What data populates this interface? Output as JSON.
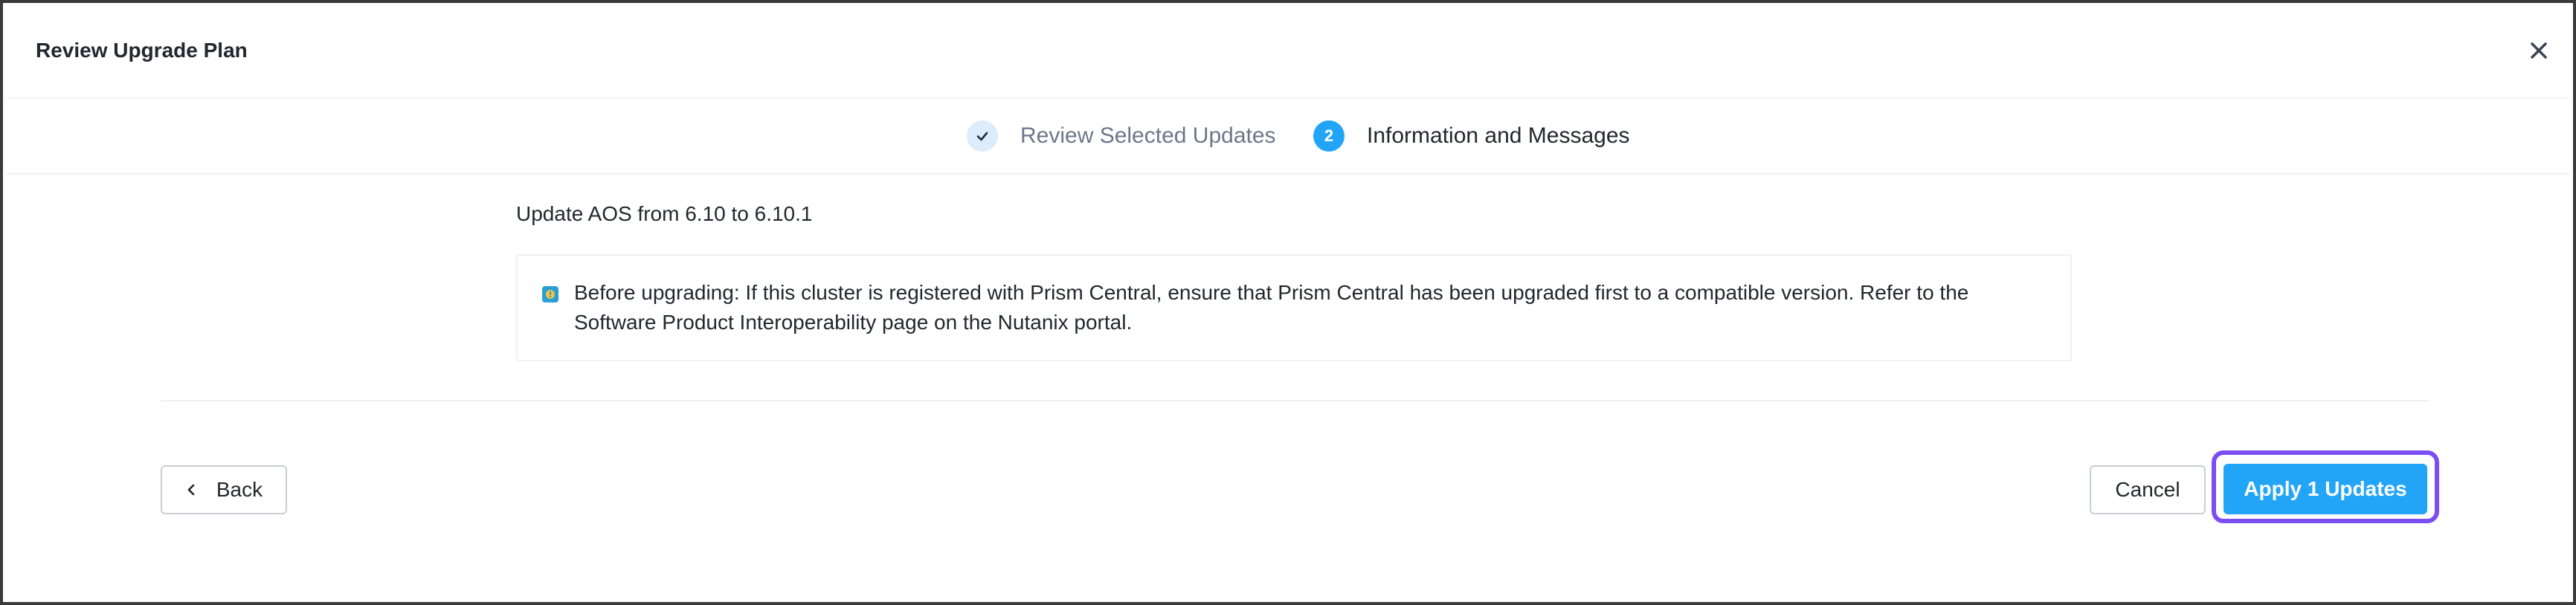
{
  "dialog": {
    "title": "Review Upgrade Plan"
  },
  "stepper": {
    "steps": [
      {
        "label": "Review Selected Updates",
        "state": "completed",
        "marker": "✓"
      },
      {
        "label": "Information and Messages",
        "state": "active",
        "marker": "2"
      }
    ]
  },
  "content": {
    "update_title": "Update AOS from 6.10 to 6.10.1",
    "message": {
      "icon": "info-icon",
      "text": "Before upgrading: If this cluster is registered with Prism Central, ensure that Prism Central has been upgraded first to a compatible version. Refer to the Software Product Interoperability page on the Nutanix portal."
    }
  },
  "footer": {
    "back_label": "Back",
    "cancel_label": "Cancel",
    "apply_label": "Apply 1 Updates"
  },
  "colors": {
    "primary": "#22a5f7",
    "focus_ring": "#7b4df2",
    "completed_step_bg": "#dcecfb",
    "info_icon_bg": "#2a9fd6",
    "info_icon_fg": "#f5c242"
  }
}
